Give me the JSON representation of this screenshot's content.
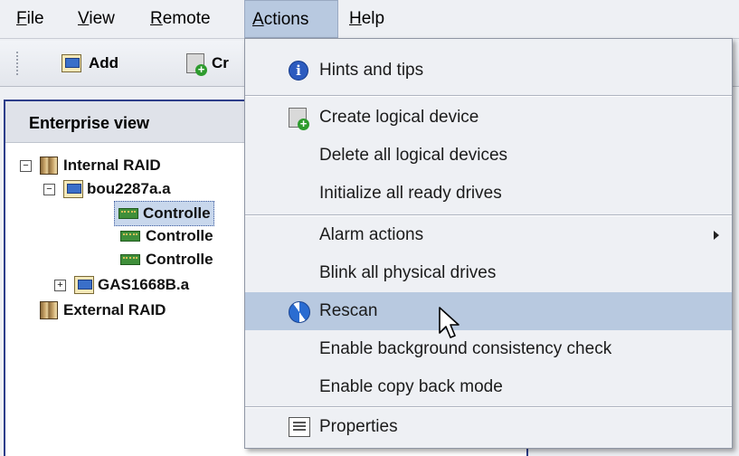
{
  "menubar": {
    "file": "File",
    "view": "View",
    "remote": "Remote",
    "actions": "Actions",
    "help": "Help",
    "file_first": "F",
    "file_rest": "ile",
    "view_first": "V",
    "view_rest": "iew",
    "remote_first": "R",
    "remote_rest": "emote",
    "actions_first": "A",
    "actions_rest": "ctions",
    "help_first": "H",
    "help_rest": "elp"
  },
  "toolbar": {
    "add_label": "Add",
    "create_label": "Cr"
  },
  "panel": {
    "title": "Enterprise view",
    "tree": {
      "internal_raid": "Internal RAID",
      "server1": "bou2287a.a",
      "controller1": "Controlle",
      "controller2": "Controlle",
      "controller3": "Controlle",
      "server2": "GAS1668B.a",
      "external_raid": "External RAID"
    },
    "expander_minus": "−",
    "expander_plus": "+"
  },
  "actions_menu": {
    "hints": "Hints and tips",
    "create_logical": "Create logical device",
    "delete_logical": "Delete all logical devices",
    "initialize_drives": "Initialize all ready drives",
    "alarm_actions": "Alarm actions",
    "blink_drives": "Blink all physical drives",
    "rescan": "Rescan",
    "enable_consistency": "Enable background consistency check",
    "enable_copyback": "Enable copy back mode",
    "properties": "Properties"
  },
  "icons": {
    "info": "info-icon",
    "create": "create-logical-icon",
    "rescan": "rescan-icon",
    "properties": "properties-icon",
    "submenu": "submenu-arrow-icon"
  },
  "colors": {
    "menu_hover": "#b8c9e0",
    "panel_border": "#2d3e8a",
    "selection": "#c8d7ec"
  }
}
